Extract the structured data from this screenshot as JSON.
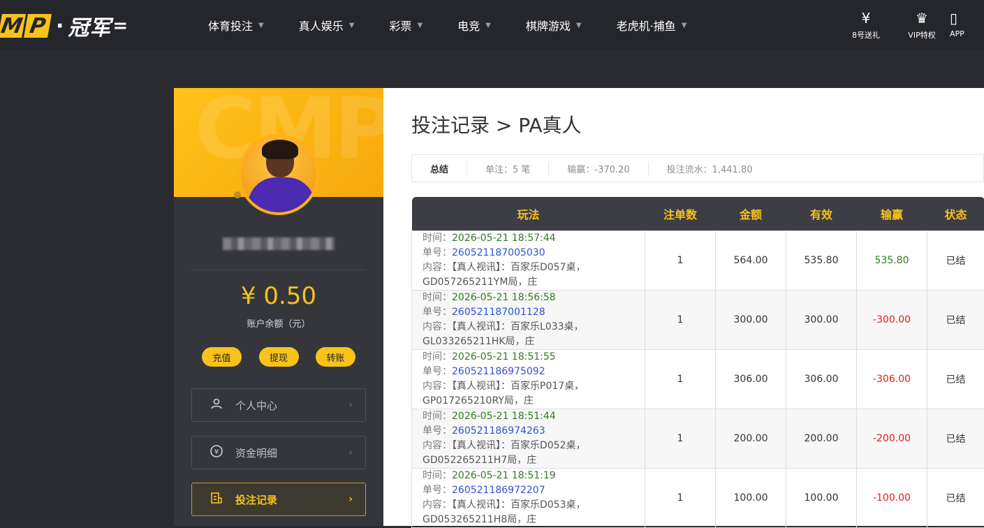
{
  "logo": {
    "mp_letters": [
      "M",
      "P"
    ],
    "dot": "·",
    "brand": "冠军",
    "tail": "="
  },
  "nav": [
    {
      "label": "体育投注"
    },
    {
      "label": "真人娱乐"
    },
    {
      "label": "彩票"
    },
    {
      "label": "电竞"
    },
    {
      "label": "棋牌游戏"
    },
    {
      "label": "老虎机·捕鱼"
    }
  ],
  "top_icons": [
    {
      "label": "8号送礼",
      "icon": "gift-icon"
    },
    {
      "label": "VIP特权",
      "icon": "crown-icon"
    },
    {
      "label": "APP",
      "icon": "phone-icon"
    }
  ],
  "sidebar": {
    "watermark": "CMP",
    "balance": "¥ 0.50",
    "balance_label": "账户余额（元）",
    "actions": [
      {
        "label": "充值"
      },
      {
        "label": "提现"
      },
      {
        "label": "转账"
      }
    ],
    "menu": [
      {
        "label": "个人中心",
        "icon": "user-icon"
      },
      {
        "label": "资金明细",
        "icon": "money-cycle-icon"
      },
      {
        "label": "投注记录",
        "icon": "betting-record-icon",
        "active": true
      }
    ]
  },
  "main": {
    "title": "投注记录 > PA真人",
    "summary": {
      "title": "总结",
      "bets": "单注：5 笔",
      "profit": "输赢：-370.20",
      "turnover": "投注流水：1,441.80"
    },
    "table": {
      "headers": [
        "玩法",
        "注单数",
        "金额",
        "有效",
        "输赢",
        "状态"
      ],
      "labels": {
        "time": "时间：",
        "order": "单号：",
        "content": "内容："
      },
      "rows": [
        {
          "time": "2026-05-21 18:57:44",
          "order": "260521187005030",
          "content_1": "【真人视讯】：百家乐D057桌，",
          "content_2": "GD057265211YM局，庄",
          "count": "1",
          "amount": "564.00",
          "valid": "535.80",
          "result": "535.80",
          "result_type": "win",
          "status": "已结"
        },
        {
          "time": "2026-05-21 18:56:58",
          "order": "260521187001128",
          "content_1": "【真人视讯】：百家乐L033桌，",
          "content_2": "GL033265211HK局，庄",
          "count": "1",
          "amount": "300.00",
          "valid": "300.00",
          "result": "-300.00",
          "result_type": "lose",
          "status": "已结"
        },
        {
          "time": "2026-05-21 18:51:55",
          "order": "260521186975092",
          "content_1": "【真人视讯】：百家乐P017桌，",
          "content_2": "GP017265210RY局，庄",
          "count": "1",
          "amount": "306.00",
          "valid": "306.00",
          "result": "-306.00",
          "result_type": "lose",
          "status": "已结"
        },
        {
          "time": "2026-05-21 18:51:44",
          "order": "260521186974263",
          "content_1": "【真人视讯】：百家乐D052桌，",
          "content_2": "GD052265211H7局，庄",
          "count": "1",
          "amount": "200.00",
          "valid": "200.00",
          "result": "-200.00",
          "result_type": "lose",
          "status": "已结"
        },
        {
          "time": "2026-05-21 18:51:19",
          "order": "260521186972207",
          "content_1": "【真人视讯】：百家乐D053桌，",
          "content_2": "GD053265211H8局，庄",
          "count": "1",
          "amount": "100.00",
          "valid": "100.00",
          "result": "-100.00",
          "result_type": "lose",
          "status": "已结"
        }
      ]
    }
  },
  "colors": {
    "accent": "#f7c21b",
    "win": "#2d7d1e",
    "lose": "#e0201b",
    "link": "#2f55c9"
  }
}
